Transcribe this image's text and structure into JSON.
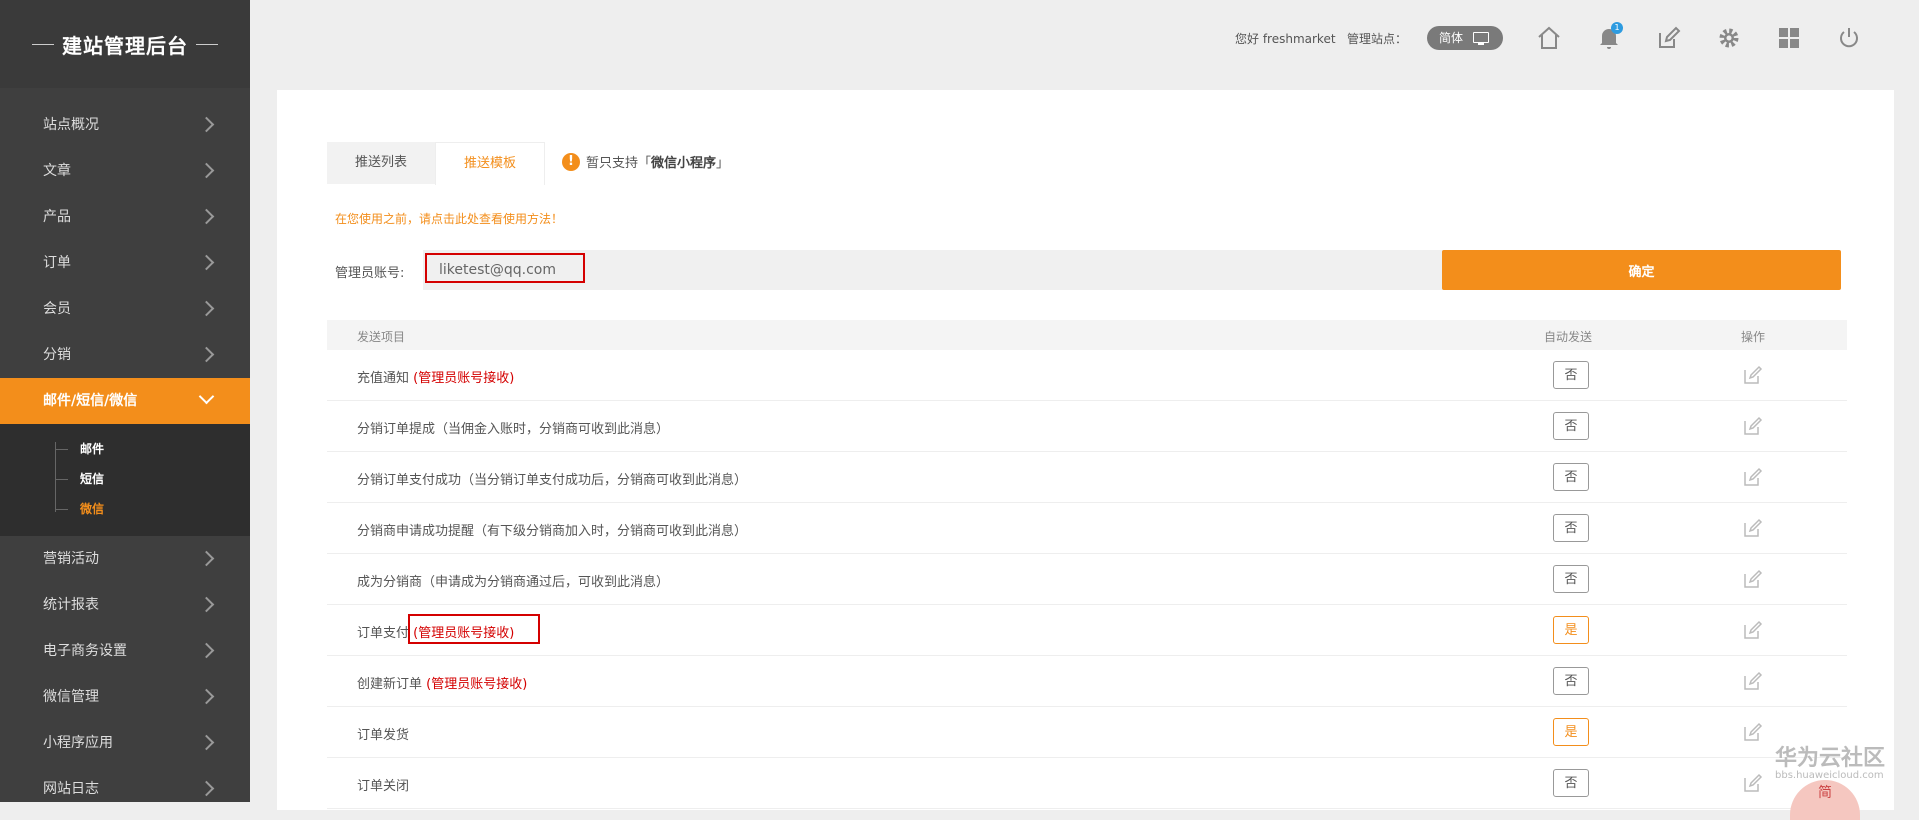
{
  "brand": {
    "title": "建站管理后台"
  },
  "sidebar": {
    "items": [
      {
        "label": "站点概况"
      },
      {
        "label": "文章"
      },
      {
        "label": "产品"
      },
      {
        "label": "订单"
      },
      {
        "label": "会员"
      },
      {
        "label": "分销"
      },
      {
        "label": "邮件/短信/微信",
        "active": true
      }
    ],
    "subitems": [
      {
        "label": "邮件"
      },
      {
        "label": "短信"
      },
      {
        "label": "微信",
        "current": true
      }
    ],
    "items_after": [
      {
        "label": "营销活动"
      },
      {
        "label": "统计报表"
      },
      {
        "label": "电子商务设置"
      },
      {
        "label": "微信管理"
      },
      {
        "label": "小程序应用"
      },
      {
        "label": "网站日志"
      }
    ]
  },
  "topbar": {
    "greeting": "您好 freshmarket",
    "site_label": "管理站点：",
    "lang": "简体",
    "notification_count": "1",
    "icons": [
      "home-icon",
      "bell-icon",
      "edit-icon",
      "gear-icon",
      "grid-icon",
      "power-icon"
    ]
  },
  "main": {
    "tabs": [
      {
        "label": "推送列表"
      },
      {
        "label": "推送模板",
        "active": true
      }
    ],
    "notice_prefix": "暂只支持「",
    "notice_bold": "微信小程序",
    "notice_suffix": "」",
    "tip": "在您使用之前，请点击此处查看使用方法！",
    "account_label": "管理员账号:",
    "account_value": "liketest@qq.com",
    "confirm_label": "确定",
    "table": {
      "headers": [
        "发送项目",
        "自动发送",
        "操作"
      ],
      "rows": [
        {
          "name": "充值通知",
          "note": "(管理员账号接收)",
          "auto": "否",
          "on": false
        },
        {
          "name": "分销订单提成（当佣金入账时，分销商可收到此消息）",
          "note": "",
          "auto": "否",
          "on": false
        },
        {
          "name": "分销订单支付成功（当分销订单支付成功后，分销商可收到此消息）",
          "note": "",
          "auto": "否",
          "on": false
        },
        {
          "name": "分销商申请成功提醒（有下级分销商加入时，分销商可收到此消息）",
          "note": "",
          "auto": "否",
          "on": false
        },
        {
          "name": "成为分销商（申请成为分销商通过后，可收到此消息）",
          "note": "",
          "auto": "否",
          "on": false
        },
        {
          "name": "订单支付",
          "note": "(管理员账号接收)",
          "auto": "是",
          "on": true
        },
        {
          "name": "创建新订单",
          "note": "(管理员账号接收)",
          "auto": "否",
          "on": false
        },
        {
          "name": "订单发货",
          "note": "",
          "auto": "是",
          "on": true
        },
        {
          "name": "订单关闭",
          "note": "",
          "auto": "否",
          "on": false
        }
      ]
    }
  },
  "watermark": {
    "title": "华为云社区",
    "url": "bbs.huaweicloud.com",
    "corner": "简"
  },
  "colors": {
    "accent": "#f38e1b",
    "sidebar": "#3f3f3f",
    "highlight": "#d40000"
  }
}
